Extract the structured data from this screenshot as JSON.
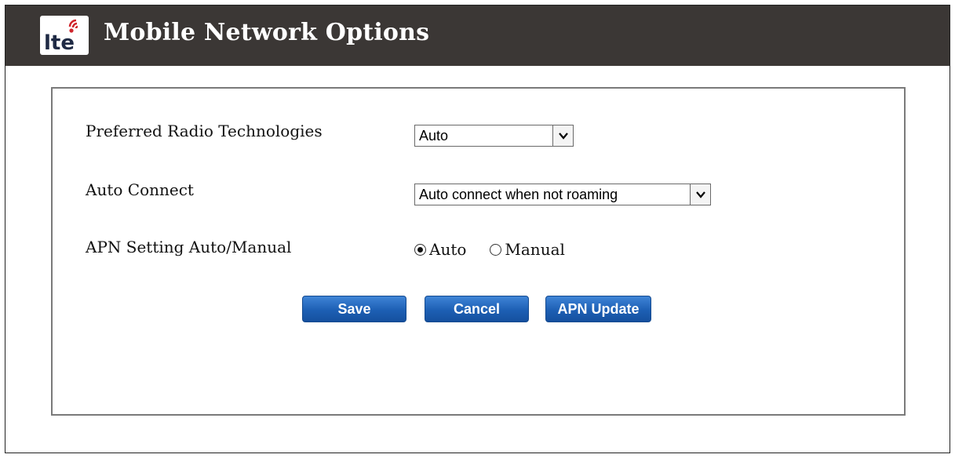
{
  "header": {
    "title": "Mobile Network Options",
    "logo_text": "lte",
    "background": "#3b3735"
  },
  "form": {
    "radio_tech": {
      "label": "Preferred Radio Technologies",
      "value": "Auto"
    },
    "auto_connect": {
      "label": "Auto Connect",
      "value": "Auto connect when not roaming"
    },
    "apn_setting": {
      "label": "APN Setting Auto/Manual",
      "options": [
        "Auto",
        "Manual"
      ],
      "selected": "Auto"
    }
  },
  "buttons": {
    "save": "Save",
    "cancel": "Cancel",
    "apn_update": "APN Update",
    "color": "#1d5fb4"
  },
  "icons": {
    "logo": "lte-logo-icon",
    "select_arrow": "chevron-down-icon"
  }
}
